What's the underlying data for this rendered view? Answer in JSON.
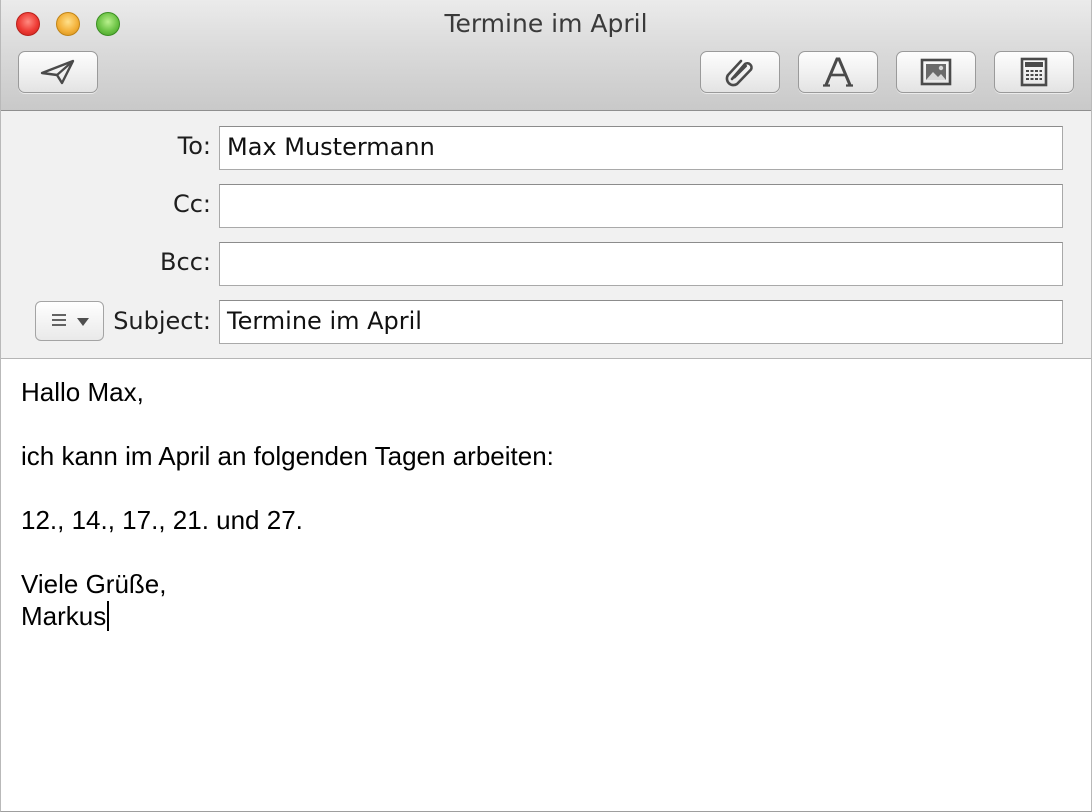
{
  "window": {
    "title": "Termine im April"
  },
  "toolbar": {
    "send_icon": "paper-plane-icon",
    "attach_icon": "paperclip-icon",
    "fonts_icon": "font-letter-a-icon",
    "photo_icon": "photo-browser-icon",
    "stationery_icon": "stationery-icon"
  },
  "header": {
    "to_label": "To:",
    "to_value": "Max Mustermann",
    "cc_label": "Cc:",
    "cc_value": "",
    "bcc_label": "Bcc:",
    "bcc_value": "",
    "subject_label": "Subject:",
    "subject_value": "Termine im April",
    "priority_icon": "list-menu-icon"
  },
  "body": {
    "lines": [
      "Hallo Max,",
      "",
      "ich kann im April an folgenden Tagen arbeiten:",
      "",
      "12., 14., 17., 21. und 27.",
      "",
      "Viele Grüße,",
      "Markus"
    ]
  },
  "colors": {
    "close": "#ee3b35",
    "minimize": "#f3b13a",
    "maximize": "#6cc345"
  }
}
